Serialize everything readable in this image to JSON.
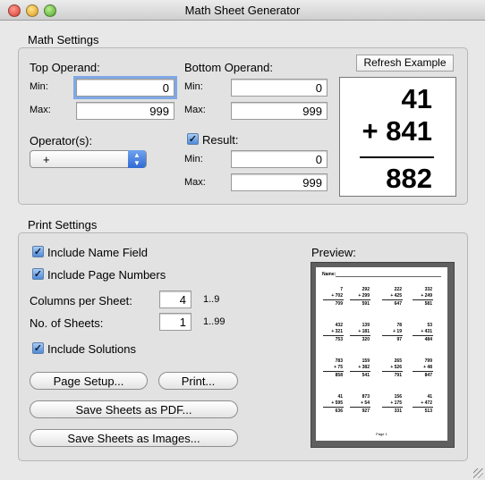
{
  "window": {
    "title": "Math Sheet Generator"
  },
  "math_settings": {
    "title": "Math Settings",
    "top_operand": {
      "label": "Top Operand:",
      "min_label": "Min:",
      "min_value": "0",
      "max_label": "Max:",
      "max_value": "999"
    },
    "bottom_operand": {
      "label": "Bottom Operand:",
      "min_label": "Min:",
      "min_value": "0",
      "max_label": "Max:",
      "max_value": "999"
    },
    "operator": {
      "label": "Operator(s):",
      "selected": "+"
    },
    "result": {
      "label": "Result:",
      "checked": true,
      "min_label": "Min:",
      "min_value": "0",
      "max_label": "Max:",
      "max_value": "999"
    },
    "refresh_label": "Refresh Example",
    "example": {
      "top": "41",
      "bottom": "+ 841",
      "answer": "882"
    }
  },
  "print_settings": {
    "title": "Print Settings",
    "include_name_field": "Include Name Field",
    "include_page_numbers": "Include Page Numbers",
    "columns_label": "Columns per Sheet:",
    "columns_value": "4",
    "columns_range": "1..9",
    "sheets_label": "No. of Sheets:",
    "sheets_value": "1",
    "sheets_range": "1..99",
    "include_solutions": "Include Solutions",
    "page_setup_label": "Page Setup...",
    "print_label": "Print...",
    "save_pdf_label": "Save Sheets as PDF...",
    "save_images_label": "Save Sheets as Images...",
    "preview_label": "Preview:",
    "preview": {
      "name_label": "Name:",
      "page_label": "Page 1",
      "problems": [
        [
          "7",
          "+ 702",
          "709"
        ],
        [
          "292",
          "+ 299",
          "591"
        ],
        [
          "222",
          "+ 425",
          "647"
        ],
        [
          "332",
          "+ 249",
          "581"
        ],
        [
          "432",
          "+ 321",
          "753"
        ],
        [
          "139",
          "+ 181",
          "320"
        ],
        [
          "78",
          "+ 19",
          "97"
        ],
        [
          "53",
          "+ 431",
          "484"
        ],
        [
          "783",
          "+ 75",
          "858"
        ],
        [
          "159",
          "+ 382",
          "541"
        ],
        [
          "265",
          "+ 526",
          "791"
        ],
        [
          "799",
          "+ 48",
          "847"
        ],
        [
          "41",
          "+ 595",
          "636"
        ],
        [
          "873",
          "+ 54",
          "927"
        ],
        [
          "156",
          "+ 175",
          "331"
        ],
        [
          "41",
          "+ 472",
          "513"
        ]
      ]
    }
  }
}
